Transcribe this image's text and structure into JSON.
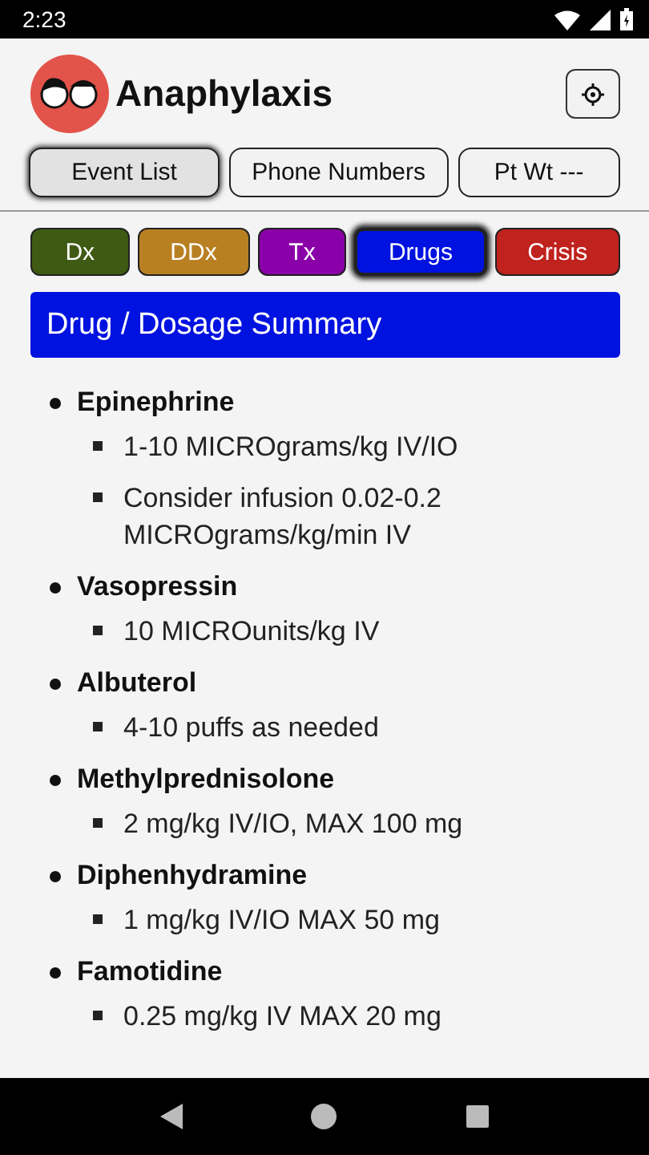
{
  "status_bar": {
    "time": "2:23"
  },
  "header": {
    "title": "Anaphylaxis"
  },
  "top_buttons": [
    {
      "label": "Event List",
      "selected": true
    },
    {
      "label": "Phone Numbers",
      "selected": false
    },
    {
      "label": "Pt Wt ---",
      "selected": false
    }
  ],
  "section_tabs": [
    {
      "label": "Dx",
      "color": "#3f5a12",
      "selected": false
    },
    {
      "label": "DDx",
      "color": "#b98022",
      "selected": false
    },
    {
      "label": "Tx",
      "color": "#8a00a8",
      "selected": false
    },
    {
      "label": "Drugs",
      "color": "#0012e0",
      "selected": true
    },
    {
      "label": "Crisis",
      "color": "#c0221e",
      "selected": false
    }
  ],
  "banner": {
    "title": "Drug / Dosage Summary"
  },
  "drugs": [
    {
      "name": "Epinephrine",
      "doses": [
        "1-10 MICROgrams/kg IV/IO",
        "Consider infusion 0.02-0.2 MICROgrams/kg/min IV"
      ]
    },
    {
      "name": "Vasopressin",
      "doses": [
        "10 MICROunits/kg IV"
      ]
    },
    {
      "name": "Albuterol",
      "doses": [
        "4-10 puffs as needed"
      ]
    },
    {
      "name": "Methylprednisolone",
      "doses": [
        "2 mg/kg IV/IO, MAX 100 mg"
      ]
    },
    {
      "name": "Diphenhydramine",
      "doses": [
        "1 mg/kg IV/IO MAX 50 mg"
      ]
    },
    {
      "name": "Famotidine",
      "doses": [
        "0.25 mg/kg IV MAX 20 mg"
      ]
    }
  ]
}
